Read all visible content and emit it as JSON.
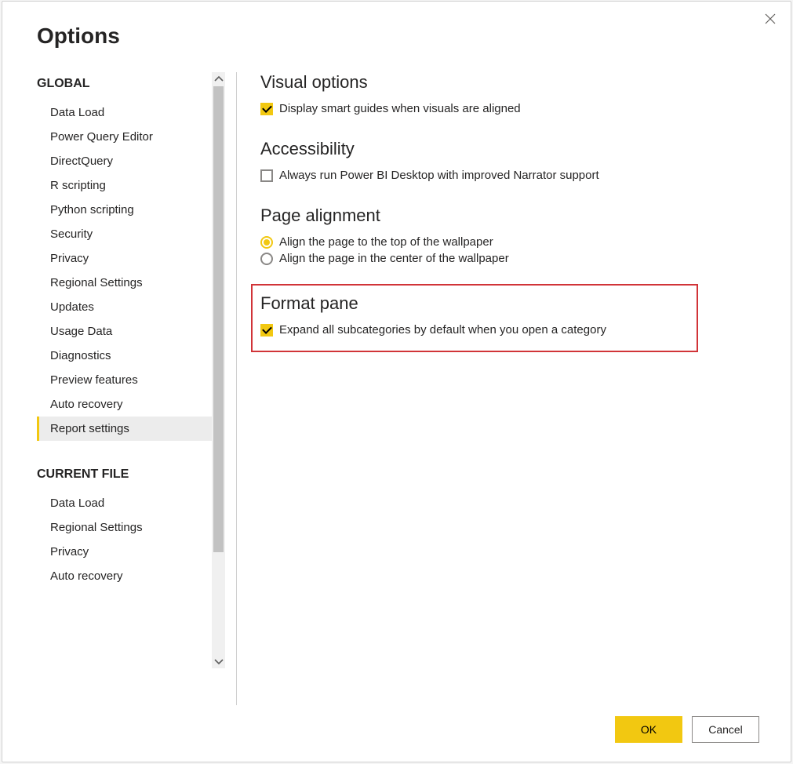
{
  "dialog": {
    "title": "Options"
  },
  "sidebar": {
    "sections": [
      {
        "header": "GLOBAL",
        "items": [
          {
            "label": "Data Load",
            "selected": false
          },
          {
            "label": "Power Query Editor",
            "selected": false
          },
          {
            "label": "DirectQuery",
            "selected": false
          },
          {
            "label": "R scripting",
            "selected": false
          },
          {
            "label": "Python scripting",
            "selected": false
          },
          {
            "label": "Security",
            "selected": false
          },
          {
            "label": "Privacy",
            "selected": false
          },
          {
            "label": "Regional Settings",
            "selected": false
          },
          {
            "label": "Updates",
            "selected": false
          },
          {
            "label": "Usage Data",
            "selected": false
          },
          {
            "label": "Diagnostics",
            "selected": false
          },
          {
            "label": "Preview features",
            "selected": false
          },
          {
            "label": "Auto recovery",
            "selected": false
          },
          {
            "label": "Report settings",
            "selected": true
          }
        ]
      },
      {
        "header": "CURRENT FILE",
        "items": [
          {
            "label": "Data Load",
            "selected": false
          },
          {
            "label": "Regional Settings",
            "selected": false
          },
          {
            "label": "Privacy",
            "selected": false
          },
          {
            "label": "Auto recovery",
            "selected": false
          }
        ]
      }
    ]
  },
  "content": {
    "groups": [
      {
        "title": "Visual options",
        "highlighted": false,
        "options": [
          {
            "type": "checkbox",
            "checked": true,
            "label": "Display smart guides when visuals are aligned"
          }
        ]
      },
      {
        "title": "Accessibility",
        "highlighted": false,
        "options": [
          {
            "type": "checkbox",
            "checked": false,
            "label": "Always run Power BI Desktop with improved Narrator support"
          }
        ]
      },
      {
        "title": "Page alignment",
        "highlighted": false,
        "options": [
          {
            "type": "radio",
            "checked": true,
            "label": "Align the page to the top of the wallpaper"
          },
          {
            "type": "radio",
            "checked": false,
            "label": "Align the page in the center of the wallpaper"
          }
        ]
      },
      {
        "title": "Format pane",
        "highlighted": true,
        "options": [
          {
            "type": "checkbox",
            "checked": true,
            "label": "Expand all subcategories by default when you open a category"
          }
        ]
      }
    ]
  },
  "footer": {
    "ok": "OK",
    "cancel": "Cancel"
  }
}
